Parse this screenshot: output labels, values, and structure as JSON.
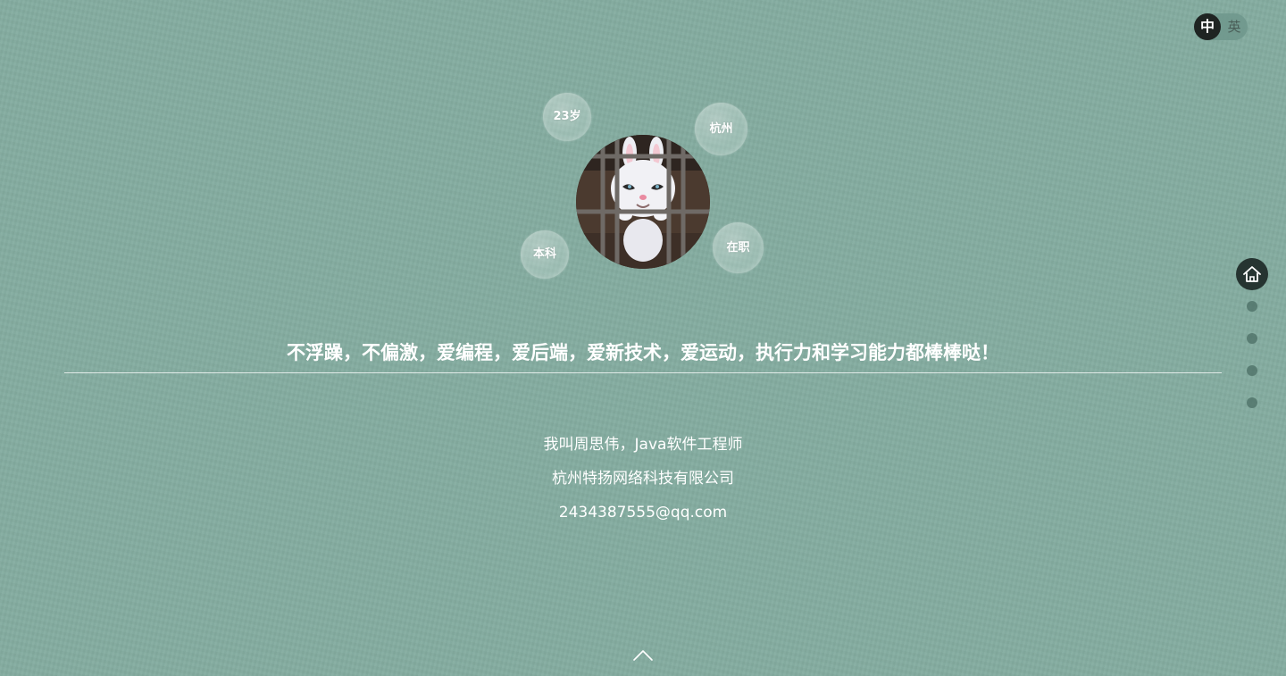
{
  "language_toggle": {
    "zh_label": "中",
    "en_label": "英",
    "active": "zh"
  },
  "profile": {
    "avatar_icon": "rabbit-avatar",
    "tags": {
      "age": "23岁",
      "city": "杭州",
      "education": "本科",
      "status": "在职"
    },
    "motto": "不浮躁，不偏激，爱编程，爱后端，爱新技术，爱运动，执行力和学习能力都棒棒哒！",
    "intro": "我叫周思伟，Java软件工程师",
    "company": "杭州特扬网络科技有限公司",
    "email": "2434387555@qq.com"
  },
  "side_nav": {
    "home_icon": "home-icon",
    "page_count": 5,
    "active_index": 0
  },
  "bottom": {
    "icon": "chevron-up-icon"
  },
  "colors": {
    "background": "#84aca0",
    "nav_active": "#263431",
    "text": "#ffffff"
  }
}
